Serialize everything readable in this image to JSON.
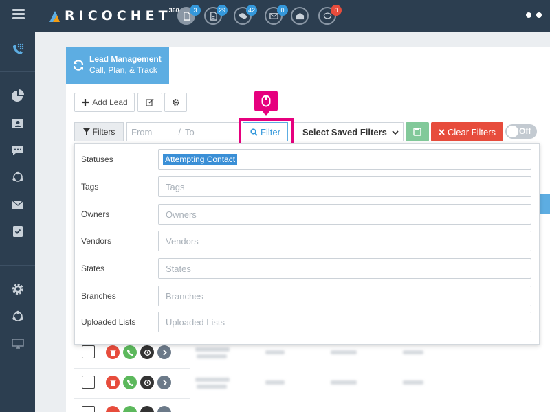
{
  "app": {
    "logo_text": "RICOCHET",
    "logo_sup": "360"
  },
  "topbar": {
    "icons": [
      {
        "name": "documents-icon",
        "badge": "3",
        "badge_color": "#3498db"
      },
      {
        "name": "document-list-icon",
        "badge": "29",
        "badge_color": "#3498db"
      },
      {
        "name": "chat-icon",
        "badge": "42",
        "badge_color": "#3498db"
      },
      {
        "name": "mail-icon",
        "badge": "0",
        "badge_color": "#3498db"
      },
      {
        "name": "open-mail-icon",
        "badge": "",
        "badge_color": ""
      },
      {
        "name": "comment-icon",
        "badge": "0",
        "badge_color": "#e74c3c"
      }
    ]
  },
  "tab": {
    "title": "Lead Management",
    "subtitle": "Call, Plan, & Track"
  },
  "toolbar": {
    "add_lead_label": "Add Lead"
  },
  "filterbar": {
    "filters_label": "Filters",
    "from_placeholder": "From",
    "separator": "/",
    "to_placeholder": "To",
    "filter_button_label": "Filter",
    "saved_filters_label": "Select Saved Filters",
    "clear_filters_label": "Clear Filters",
    "toggle_label": "Off"
  },
  "filter_panel": {
    "rows": [
      {
        "label": "Statuses",
        "value": "Attempting Contact",
        "placeholder": ""
      },
      {
        "label": "Tags",
        "value": "",
        "placeholder": "Tags"
      },
      {
        "label": "Owners",
        "value": "",
        "placeholder": "Owners"
      },
      {
        "label": "Vendors",
        "value": "",
        "placeholder": "Vendors"
      },
      {
        "label": "States",
        "value": "",
        "placeholder": "States"
      },
      {
        "label": "Branches",
        "value": "",
        "placeholder": "Branches"
      },
      {
        "label": "Uploaded Lists",
        "value": "",
        "placeholder": "Uploaded Lists"
      }
    ]
  },
  "colors": {
    "topbar_bg": "#2c3e50",
    "accent_blue": "#5dade2",
    "danger_red": "#e74c3c",
    "save_green": "#82c99a",
    "highlight_pink": "#e6007e"
  }
}
